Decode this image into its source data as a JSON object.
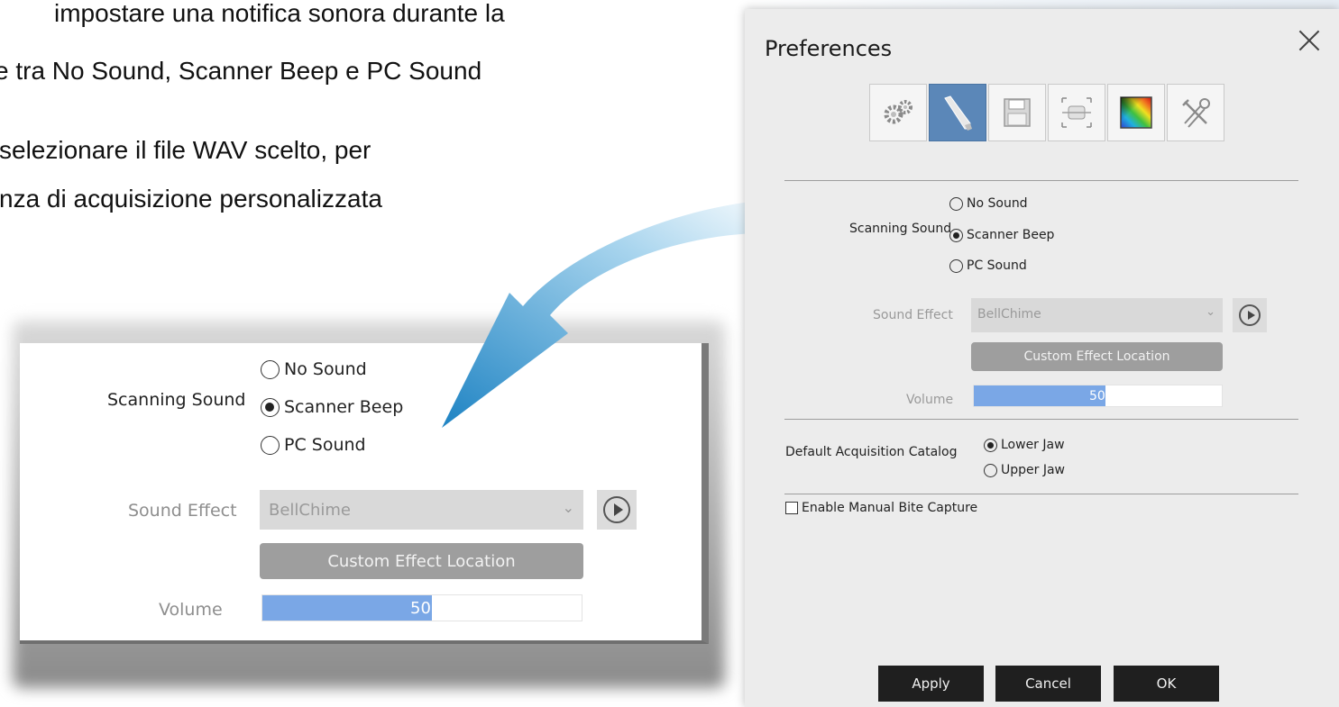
{
  "instructions": {
    "line1": "impostare una notifica sonora durante la",
    "line2": "e tra No Sound, Scanner Beep e PC Sound",
    "line3": "selezionare il file WAV scelto, per",
    "line4": "nza di acquisizione personalizzata"
  },
  "zoom_panel": {
    "scanning_sound_label": "Scanning Sound",
    "options": [
      "No Sound",
      "Scanner Beep",
      "PC Sound"
    ],
    "selected": "Scanner Beep",
    "sound_effect_label": "Sound Effect",
    "sound_effect_value": "BellChime",
    "custom_effect_label": "Custom Effect Location",
    "volume_label": "Volume",
    "volume_value": "50",
    "volume_level_percent": 53
  },
  "dialog": {
    "title": "Preferences",
    "tabs": [
      {
        "icon": "gears-icon",
        "active": false
      },
      {
        "icon": "scanner-wand-icon",
        "active": true
      },
      {
        "icon": "floppy-disk-icon",
        "active": false
      },
      {
        "icon": "tooth-scan-icon",
        "active": false
      },
      {
        "icon": "color-gradient-icon",
        "active": false
      },
      {
        "icon": "tools-icon",
        "active": false
      }
    ],
    "scanning_sound_label": "Scanning Sound",
    "sound_options": [
      "No Sound",
      "Scanner Beep",
      "PC Sound"
    ],
    "sound_selected": "Scanner Beep",
    "sound_effect_label": "Sound Effect",
    "sound_effect_value": "BellChime",
    "custom_effect_label": "Custom Effect Location",
    "volume_label": "Volume",
    "volume_value": "50",
    "volume_level_percent": 53,
    "catalog_label": "Default Acquisition Catalog",
    "catalog_options": [
      "Lower Jaw",
      "Upper Jaw"
    ],
    "catalog_selected": "Lower Jaw",
    "manual_bite_label": "Enable Manual Bite Capture",
    "manual_bite_checked": false,
    "buttons": {
      "apply": "Apply",
      "cancel": "Cancel",
      "ok": "OK"
    }
  },
  "colors": {
    "active_tab": "#5b87b8",
    "volume_fill": "#7aa7e6",
    "arrow_blue": "#2389c6",
    "button_dark": "#1f1f1f",
    "custom_button": "#9e9e9e"
  }
}
